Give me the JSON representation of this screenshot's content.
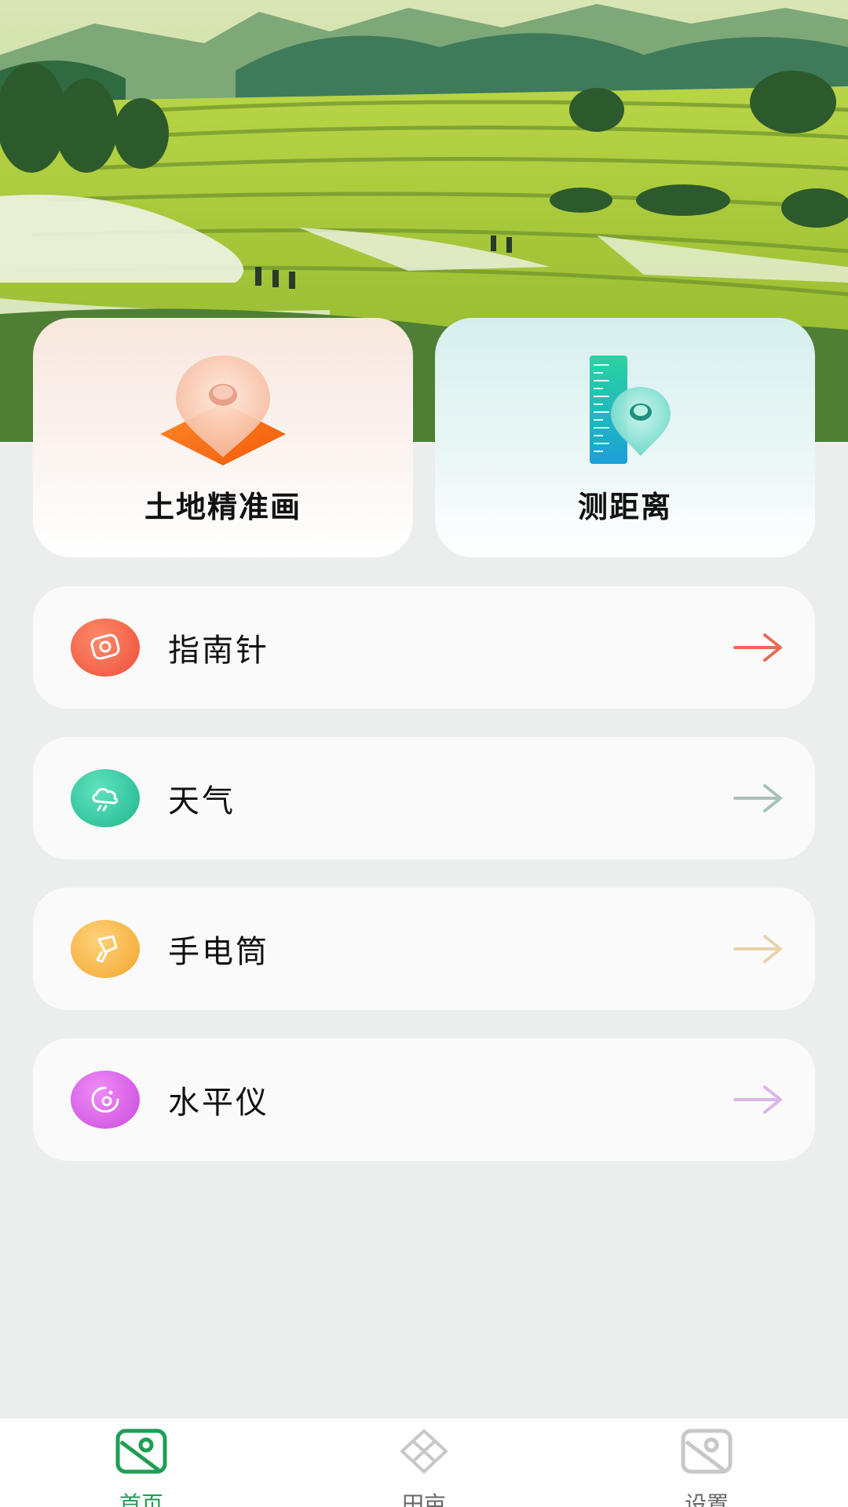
{
  "features": [
    {
      "id": "land",
      "label": "土地精准画",
      "icon": "land-pin-icon"
    },
    {
      "id": "distance",
      "label": "测距离",
      "icon": "ruler-pin-icon"
    }
  ],
  "tools": [
    {
      "label": "指南针",
      "icon": "compass-icon",
      "color": "#f0604a",
      "arrow_color": "#e86a5a"
    },
    {
      "label": "天气",
      "icon": "weather-icon",
      "color": "#2ec9a0",
      "arrow_color": "#a9c2b8"
    },
    {
      "label": "手电筒",
      "icon": "flashlight-icon",
      "color": "#f5b340",
      "arrow_color": "#e9d2ae"
    },
    {
      "label": "水平仪",
      "icon": "level-icon",
      "color": "#d864ea",
      "arrow_color": "#dcb6e6"
    }
  ],
  "nav": {
    "items": [
      {
        "label": "首页",
        "icon": "home-icon",
        "active": true
      },
      {
        "label": "田亩",
        "icon": "field-icon",
        "active": false
      },
      {
        "label": "设置",
        "icon": "settings-icon",
        "active": false
      }
    ],
    "active_color": "#1f9d55"
  }
}
